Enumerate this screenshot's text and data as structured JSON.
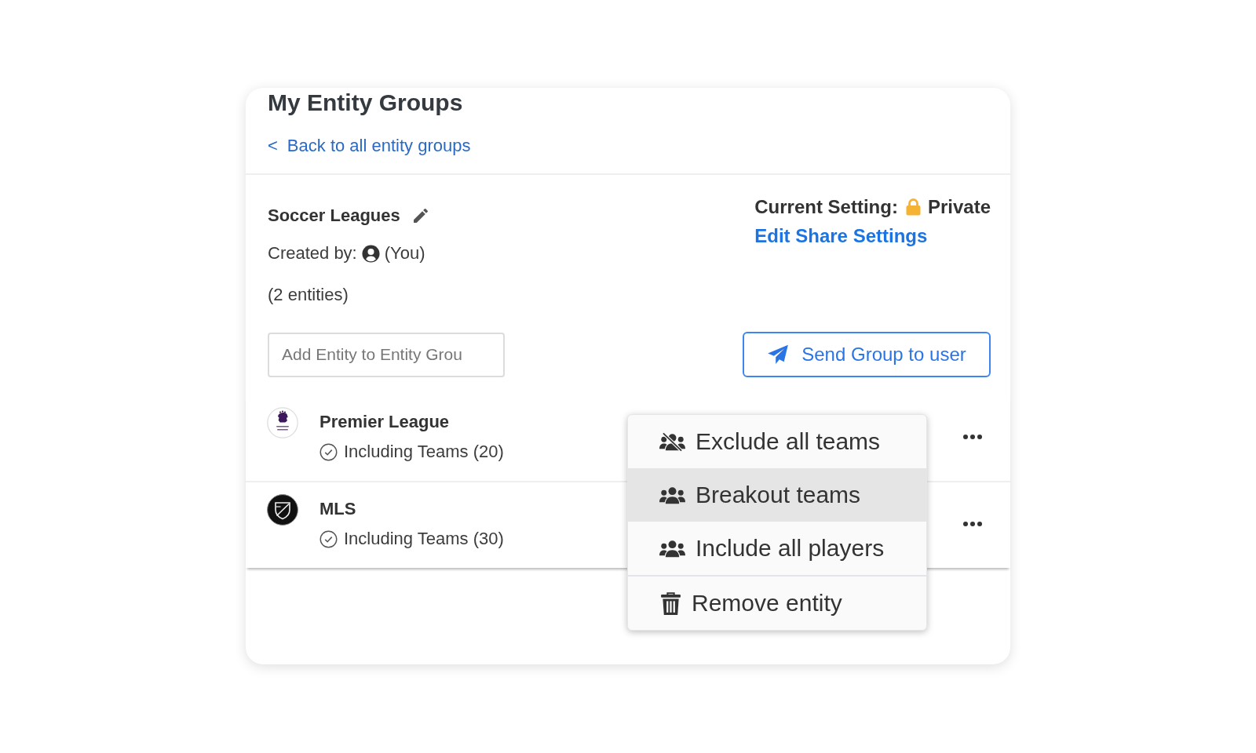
{
  "header": {
    "title": "My Entity Groups",
    "back_link": {
      "chevron": "<",
      "label": "Back to all entity groups"
    }
  },
  "group": {
    "name": "Soccer Leagues",
    "created_by": {
      "label": "Created by:",
      "user": "(You)"
    },
    "entity_count": "(2 entities)"
  },
  "sharing": {
    "label": "Current Setting:",
    "setting": "Private",
    "edit_link": "Edit Share Settings"
  },
  "add_entity_field": {
    "placeholder": "Add Entity to Entity Grou"
  },
  "send_button": {
    "label": "Send Group to user"
  },
  "entities": [
    {
      "name": "Premier League",
      "kind": "light",
      "detail": "Including Teams (20)",
      "menu": {
        "items": [
          {
            "label": "Exclude all teams",
            "kind": "exclude",
            "selected": false
          },
          {
            "label": "Breakout teams",
            "kind": "group",
            "selected": true
          },
          {
            "label": "Include all players",
            "kind": "group",
            "selected": false
          },
          {
            "label": "Remove entity",
            "kind": "remove",
            "selected": false
          }
        ]
      }
    },
    {
      "name": "MLS",
      "kind": "dark",
      "detail": "Including Teams (30)"
    }
  ]
}
